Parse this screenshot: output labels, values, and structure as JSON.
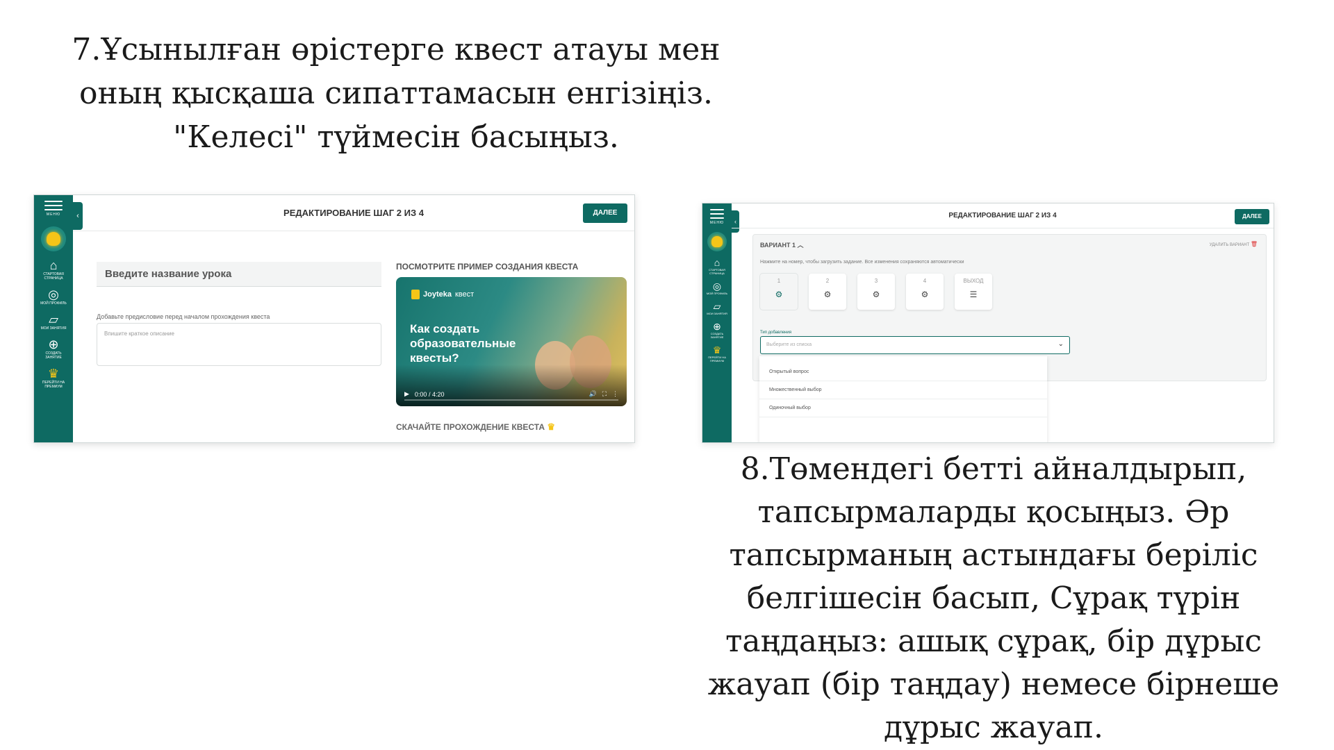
{
  "captions": {
    "step7": "7.Ұсынылған өрістерге квест атауы мен оның қысқаша сипаттамасын енгізіңіз. \"Келесі\" түймесін басыңыз.",
    "step8": "8.Төмендегі бетті айналдырып, тапсырмаларды қосыңыз. Әр тапсырманың астындағы беріліс белгішесін басып, Сұрақ түрін таңдаңыз: ашық сұрақ, бір дұрыс жауап (бір таңдау) немесе бірнеше дұрыс жауап."
  },
  "screen1": {
    "sidebar": {
      "menu_label": "МЕНЮ",
      "items": [
        {
          "icon": "home-icon",
          "label": "Стартовая страница"
        },
        {
          "icon": "profile-icon",
          "label": "Мой профиль"
        },
        {
          "icon": "folder-icon",
          "label": "Мои занятия"
        },
        {
          "icon": "plus-circle-icon",
          "label": "Создать занятие"
        },
        {
          "icon": "crown-icon",
          "label": "Перейти на премиум"
        }
      ]
    },
    "header": {
      "title": "РЕДАКТИРОВАНИЕ ШАГ 2 ИЗ 4",
      "next_label": "ДАЛЕЕ"
    },
    "form": {
      "lesson_name_placeholder": "Введите название урока",
      "preface_label": "Добавьте предисловие перед началом прохождения квеста",
      "description_placeholder": "Впишите краткое описание"
    },
    "video": {
      "heading": "ПОСМОТРИТЕ ПРИМЕР СОЗДАНИЯ КВЕСТА",
      "brand": "Joyteka",
      "brand_suffix": "квест",
      "title": "Как создать образовательные квесты?",
      "time": "0:00 / 4:20",
      "progress": 0
    },
    "download_heading": "СКАЧАЙТЕ ПРОХОЖДЕНИЕ КВЕСТА"
  },
  "screen2": {
    "sidebar": {
      "menu_label": "МЕНЮ",
      "items": [
        {
          "icon": "home-icon",
          "label": "Стартовая страница"
        },
        {
          "icon": "profile-icon",
          "label": "Мой профиль"
        },
        {
          "icon": "folder-icon",
          "label": "Мои занятия"
        },
        {
          "icon": "plus-circle-icon",
          "label": "Создать занятие"
        },
        {
          "icon": "crown-icon",
          "label": "Перейти на премиум"
        }
      ]
    },
    "header": {
      "title": "РЕДАКТИРОВАНИЕ ШАГ 2 ИЗ 4",
      "next_label": "ДАЛЕЕ"
    },
    "variant": {
      "title": "ВАРИАНТ 1",
      "delete_label": "УДАЛИТЬ ВАРИАНТ",
      "hint": "Нажмите на номер, чтобы загрузить задание. Все изменения сохраняются автоматически",
      "tasks": [
        "1",
        "2",
        "3",
        "4",
        "ВЫХОД"
      ],
      "type_label": "Тип добавления",
      "type_placeholder": "Выберите из списка",
      "options": [
        "Открытый вопрос",
        "Множественный выбор",
        "Одиночный выбор"
      ]
    }
  },
  "colors": {
    "brand": "#0e6a62",
    "accent": "#f5c518",
    "delete": "#dd3333"
  }
}
